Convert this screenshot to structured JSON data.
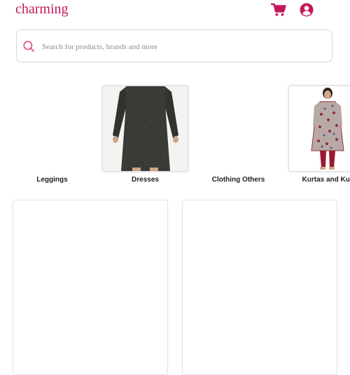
{
  "header": {
    "brand": "charming",
    "cart_icon": "cart-icon",
    "account_icon": "user-circle-icon"
  },
  "search": {
    "placeholder": "Search for products, brands and more",
    "icon": "search-icon"
  },
  "categories": [
    {
      "label": "Leggings"
    },
    {
      "label": "Dresses"
    },
    {
      "label": "Clothing Others"
    },
    {
      "label": "Kurtas and Kurtis"
    }
  ],
  "colors": {
    "brand": "#c2185b",
    "icons": "#c2185b",
    "search_icon": "#e04a78"
  }
}
